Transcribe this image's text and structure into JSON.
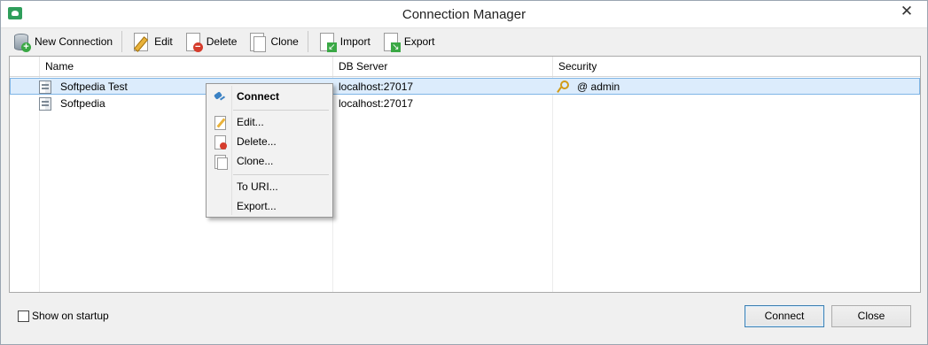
{
  "window": {
    "title": "Connection Manager",
    "close_glyph": "✕"
  },
  "toolbar": {
    "new_connection": "New Connection",
    "edit": "Edit",
    "delete": "Delete",
    "clone": "Clone",
    "import": "Import",
    "export": "Export"
  },
  "grid": {
    "columns": [
      "Name",
      "DB Server",
      "Security"
    ],
    "rows": [
      {
        "name": "Softpedia Test",
        "server": "localhost:27017",
        "security": "@ admin",
        "selected": true
      },
      {
        "name": "Softpedia",
        "server": "localhost:27017",
        "security": "",
        "selected": false
      }
    ]
  },
  "context_menu": {
    "connect": "Connect",
    "edit": "Edit...",
    "delete": "Delete...",
    "clone": "Clone...",
    "to_uri": "To URI...",
    "export": "Export..."
  },
  "footer": {
    "show_on_startup": "Show on startup",
    "show_on_startup_checked": false,
    "connect": "Connect",
    "close": "Close"
  },
  "colors": {
    "selection_bg": "#dcecfc",
    "selection_border": "#7fb5e6",
    "default_button_border": "#3c7fb1"
  }
}
